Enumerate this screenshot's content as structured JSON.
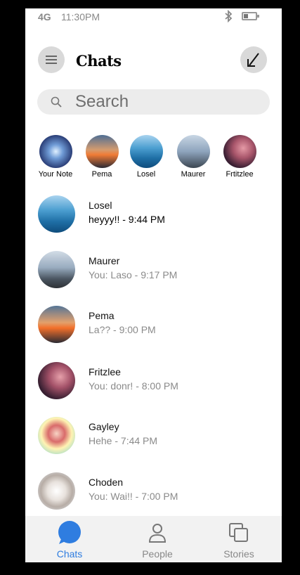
{
  "status": {
    "network": "4G",
    "time": "11:30PM"
  },
  "header": {
    "title": "Chats"
  },
  "search": {
    "placeholder": "Search"
  },
  "stories": [
    {
      "label": "Your Note",
      "bg": "radial-gradient(circle at 50% 50%, #e0f0ff 0%, #6f9bd6 30%, #2b3f78 70%, #172352 100%)"
    },
    {
      "label": "Pema",
      "bg": "linear-gradient(180deg, #4f6f94 0%, #d59b6e 45%, #f07b35 60%, #2a2a35 100%)"
    },
    {
      "label": "Losel",
      "bg": "linear-gradient(180deg, #a9d3ef 0%, #4b9ed0 40%, #1f6fa6 70%, #0f4c7c 100%)"
    },
    {
      "label": "Maurer",
      "bg": "linear-gradient(180deg, #c8d6e4 0%, #8ea4bd 50%, #3b4651 100%)"
    },
    {
      "label": "Frtitzlee",
      "bg": "radial-gradient(circle at 60% 40%, #e59aa6 0%, #a9566b 35%, #3c2034 70%, #1d1426 100%)"
    }
  ],
  "chats": [
    {
      "name": "Losel",
      "message": "heyyy!! - 9:44 PM",
      "unread": true,
      "bg": "linear-gradient(180deg, #a9d3ef 0%, #4b9ed0 40%, #1f6fa6 70%, #0f4c7c 100%)"
    },
    {
      "name": "Maurer",
      "message": "You: Laso - 9:17 PM",
      "unread": false,
      "bg": "linear-gradient(180deg, #d2dce6 0%, #98abbf 45%, #4a5560 75%, #2e3236 100%)"
    },
    {
      "name": "Pema",
      "message": "La?? - 9:00 PM",
      "unread": false,
      "bg": "linear-gradient(180deg, #557596 0%, #e3a06c 45%, #f26f2a 60%, #2a2a33 100%)"
    },
    {
      "name": "Fritzlee",
      "message": "You: donr! - 8:00 PM",
      "unread": false,
      "bg": "radial-gradient(circle at 60% 40%, #e6a0aa 0%, #a35168 35%, #3a2032 70%, #1b1425 100%)"
    },
    {
      "name": "Gayley",
      "message": "Hehe - 7:44 PM",
      "unread": false,
      "bg": "radial-gradient(circle at 50% 45%, #f7d3c4 0%, #d96b6b 30%, #fff3b3 55%, #6fd0d8 100%)"
    },
    {
      "name": "Choden",
      "message": "You: Wai!! - 7:00 PM",
      "unread": false,
      "bg": "radial-gradient(circle at 50% 50%, #ffffff 0%, #e8e2dd 35%, #b7ada6 60%, #e9f0f7 100%)"
    }
  ],
  "tabs": [
    {
      "label": "Chats",
      "icon": "chat-bubble-icon",
      "active": true
    },
    {
      "label": "People",
      "icon": "person-icon",
      "active": false
    },
    {
      "label": "Stories",
      "icon": "stories-icon",
      "active": false
    }
  ],
  "colors": {
    "accent": "#2f7de0",
    "search_bg": "#ececec",
    "tabbar_bg": "#f2f2f2"
  }
}
